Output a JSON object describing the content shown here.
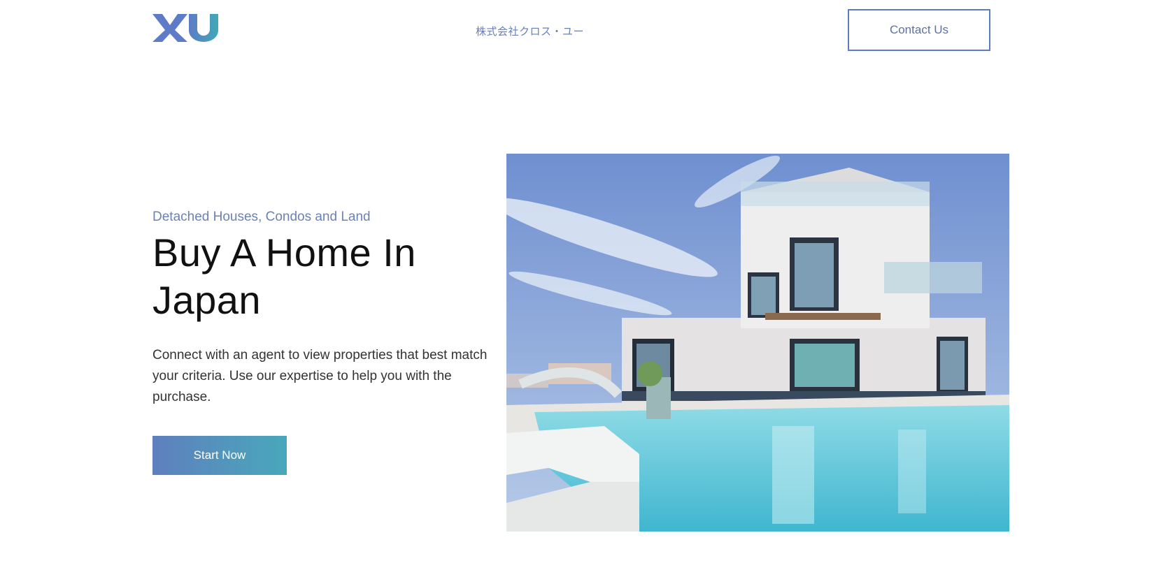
{
  "header": {
    "logo_text": "XU",
    "company_name": "株式会社クロス・ユー",
    "contact_label": "Contact Us"
  },
  "hero": {
    "eyebrow": "Detached Houses, Condos and Land",
    "headline_line1": "Buy A Home In",
    "headline_line2": "Japan",
    "description": "Connect with an agent to view properties that best match your criteria. Use our expertise to help you with the purchase.",
    "cta_label": "Start Now",
    "image_subject": "modern-white-villa-with-pool"
  },
  "colors": {
    "accent_blue": "#5d7bc6",
    "accent_teal": "#48a8bb",
    "eyebrow_text": "#6b82b3"
  }
}
